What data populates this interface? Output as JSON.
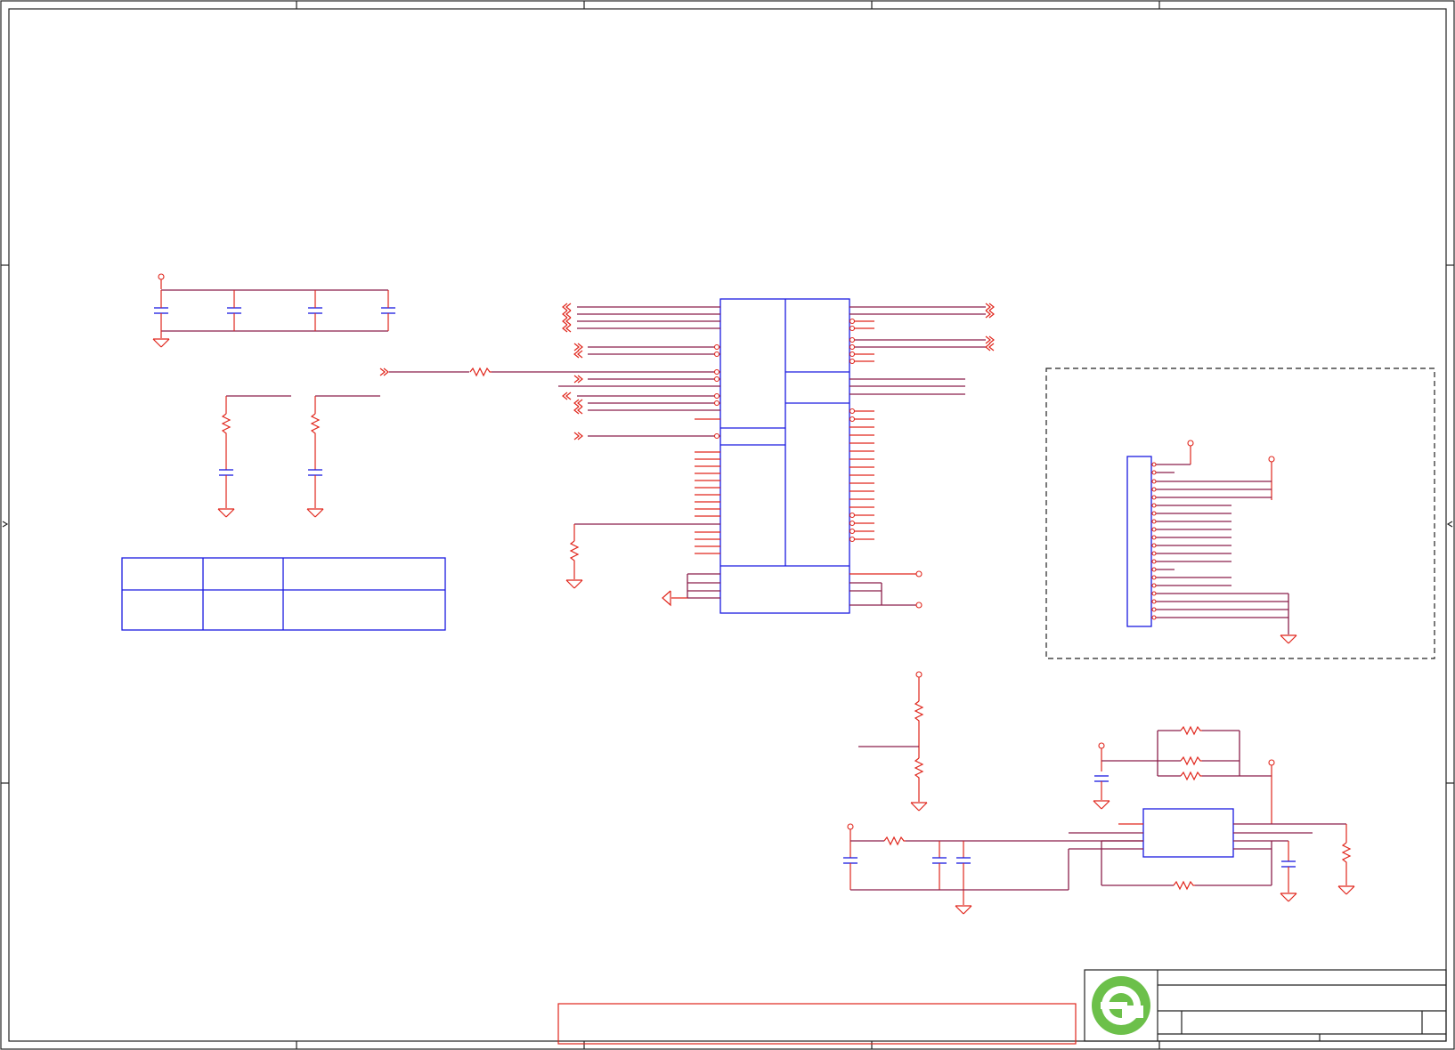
{
  "colors": {
    "frame": "#222222",
    "wire": "#8b1f4a",
    "pin": "#e0261c",
    "body": "#1a1ae0",
    "logo": "#6cc04a"
  },
  "icons": {
    "logo": "company-logo-icon",
    "ground": "ground-icon",
    "power": "power-rail-icon",
    "resistor": "resistor-icon",
    "capacitor": "capacitor-icon",
    "port": "offpage-port-icon"
  }
}
